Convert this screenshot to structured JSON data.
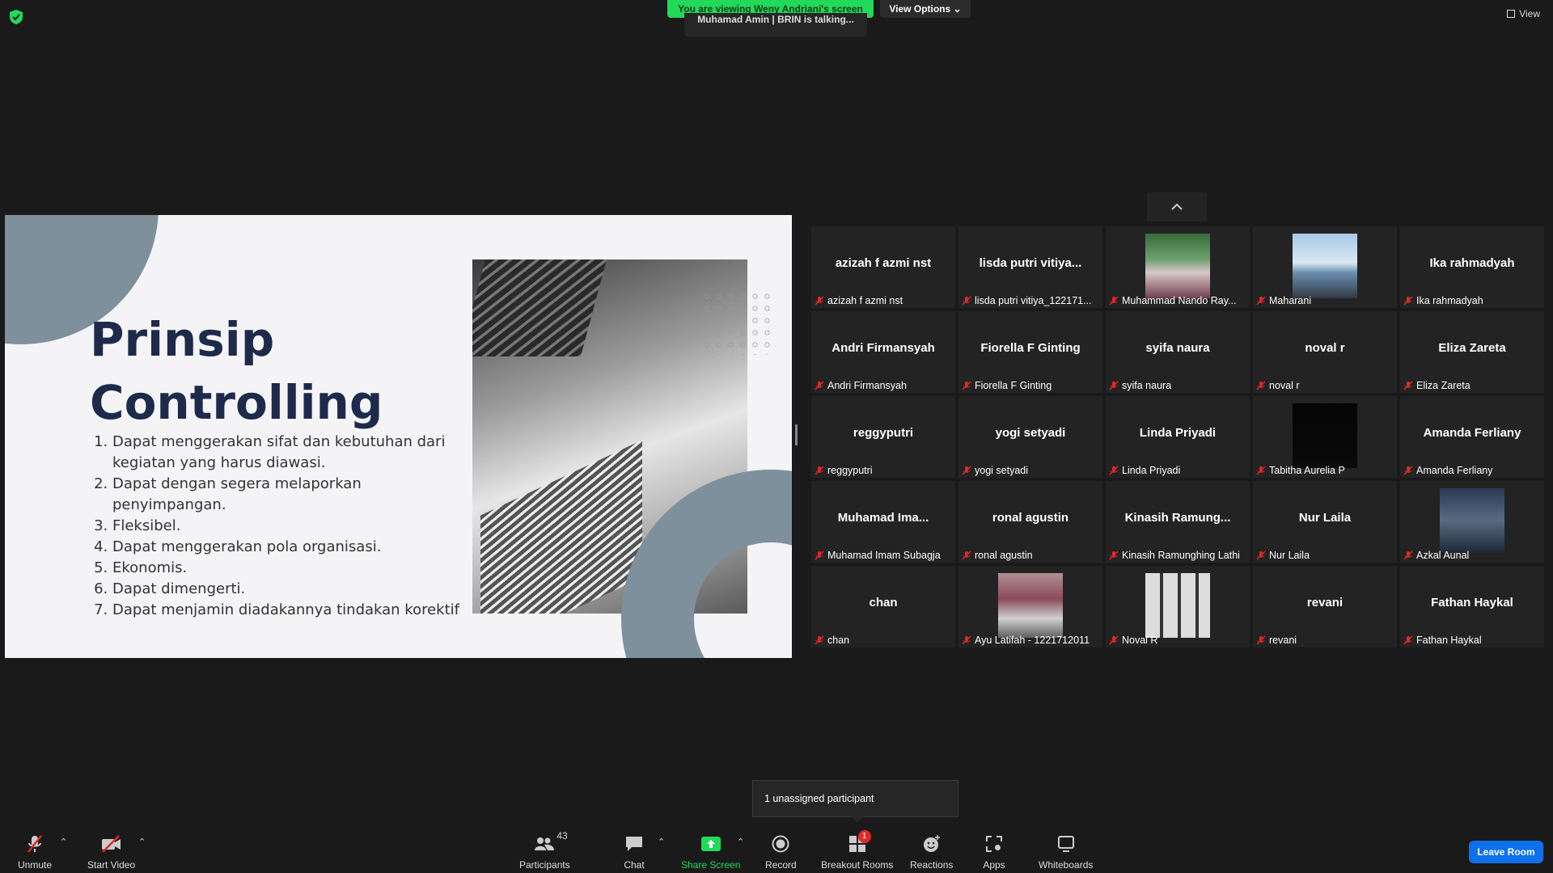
{
  "top": {
    "banner": "You are viewing Weny Andriani's screen",
    "view_options": "View Options",
    "talking": "Muhamad Amin | BRIN is talking...",
    "view": "View"
  },
  "slide": {
    "title_line1": "Prinsip",
    "title_line2": "Controlling",
    "items": [
      "Dapat menggerakan sifat dan kebutuhan dari kegiatan yang harus diawasi.",
      "Dapat dengan segera melaporkan penyimpangan.",
      "Fleksibel.",
      "Dapat menggerakan pola organisasi.",
      "Ekonomis.",
      "Dapat dimengerti.",
      "Dapat menjamin diadakannya tindakan korektif"
    ]
  },
  "participants_tiles": [
    {
      "display": "azizah f azmi nst",
      "name": "azizah f azmi nst",
      "photo": false
    },
    {
      "display": "lisda  putri  vitiya...",
      "name": "lisda putri vitiya_122171...",
      "photo": false
    },
    {
      "display": "",
      "name": "Muhammad Nando Ray...",
      "photo": true
    },
    {
      "display": "",
      "name": "Maharani",
      "photo": true
    },
    {
      "display": "Ika rahmadyah",
      "name": "Ika rahmadyah",
      "photo": false
    },
    {
      "display": "Andri Firmansyah",
      "name": "Andri Firmansyah",
      "photo": false
    },
    {
      "display": "Fiorella F Ginting",
      "name": "Fiorella F Ginting",
      "photo": false
    },
    {
      "display": "syifa naura",
      "name": "syifa naura",
      "photo": false
    },
    {
      "display": "noval r",
      "name": "noval r",
      "photo": false
    },
    {
      "display": "Eliza Zareta",
      "name": "Eliza Zareta",
      "photo": false
    },
    {
      "display": "reggyputri",
      "name": "reggyputri",
      "photo": false
    },
    {
      "display": "yogi setyadi",
      "name": "yogi setyadi",
      "photo": false
    },
    {
      "display": "Linda Priyadi",
      "name": "Linda Priyadi",
      "photo": false
    },
    {
      "display": "",
      "name": "Tabitha Aurelia P",
      "photo": true
    },
    {
      "display": "Amanda Ferliany",
      "name": "Amanda Ferliany",
      "photo": false
    },
    {
      "display": "Muhamad  Ima...",
      "name": "Muhamad Imam Subagja",
      "photo": false
    },
    {
      "display": "ronal agustin",
      "name": "ronal agustin",
      "photo": false
    },
    {
      "display": "Kinasih  Ramung...",
      "name": "Kinasih Ramunghing Lathi",
      "photo": false
    },
    {
      "display": "Nur Laila",
      "name": "Nur Laila",
      "photo": false
    },
    {
      "display": "",
      "name": "Azkal Aunal",
      "photo": true
    },
    {
      "display": "chan",
      "name": "chan",
      "photo": false
    },
    {
      "display": "",
      "name": "Ayu Latifah - 1221712011",
      "photo": true
    },
    {
      "display": "",
      "name": "Noval R",
      "photo": true
    },
    {
      "display": "revani",
      "name": "revani",
      "photo": false
    },
    {
      "display": "Fathan Haykal",
      "name": "Fathan Haykal",
      "photo": false
    }
  ],
  "popup": "1 unassigned participant",
  "toolbar": {
    "unmute": "Unmute",
    "start_video": "Start Video",
    "participants": "Participants",
    "participants_count": "43",
    "chat": "Chat",
    "share_screen": "Share Screen",
    "record": "Record",
    "breakout_rooms": "Breakout Rooms",
    "breakout_badge": "1",
    "reactions": "Reactions",
    "apps": "Apps",
    "whiteboards": "Whiteboards",
    "leave_room": "Leave Room"
  },
  "colors": {
    "accent_green": "#23d959",
    "leave_blue": "#0e71eb",
    "mic_red": "#e02828",
    "slide_title": "#1e2a4a"
  }
}
